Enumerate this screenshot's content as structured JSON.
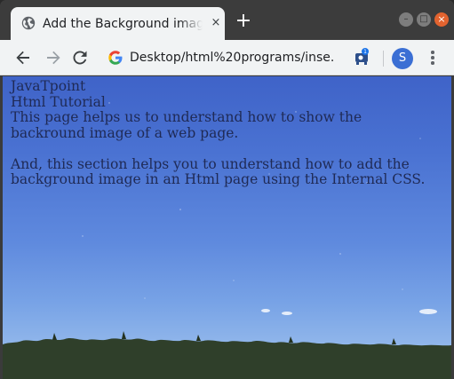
{
  "tab": {
    "title": "Add the Background image",
    "close_glyph": "×",
    "favicon": "globe-icon"
  },
  "new_tab_glyph": "+",
  "window_controls": {
    "minimize_glyph": "–",
    "maximize_glyph": "□",
    "close_glyph": "×"
  },
  "toolbar": {
    "url": "Desktop/html%20programs/inse...",
    "profile_initial": "S",
    "extension_badge": "1"
  },
  "page": {
    "line1": "JavaTpoint",
    "line2": "Html Tutorial",
    "para1": "This page helps us to understand how to show the backround image of a web page.",
    "para2": "And, this section helps you to understand how to add the background image in an Html page using the Internal CSS."
  },
  "colors": {
    "accent": "#3b6fd4",
    "close_button": "#e2632f",
    "sky_top": "#3f63c8",
    "sky_bottom": "#a3c2ea",
    "treeline": "#2f3f2a"
  }
}
